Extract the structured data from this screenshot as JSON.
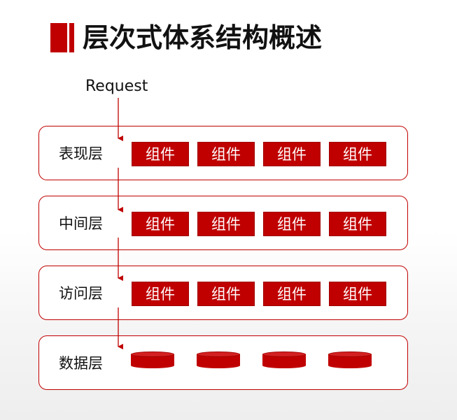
{
  "title": "层次式体系结构概述",
  "request_label": "Request",
  "colors": {
    "accent": "#c00000",
    "text": "#111111"
  },
  "layers": [
    {
      "label": "表现层",
      "components": [
        "组件",
        "组件",
        "组件",
        "组件"
      ]
    },
    {
      "label": "中间层",
      "components": [
        "组件",
        "组件",
        "组件",
        "组件"
      ]
    },
    {
      "label": "访问层",
      "components": [
        "组件",
        "组件",
        "组件",
        "组件"
      ]
    },
    {
      "label": "数据层",
      "databases": 4
    }
  ]
}
